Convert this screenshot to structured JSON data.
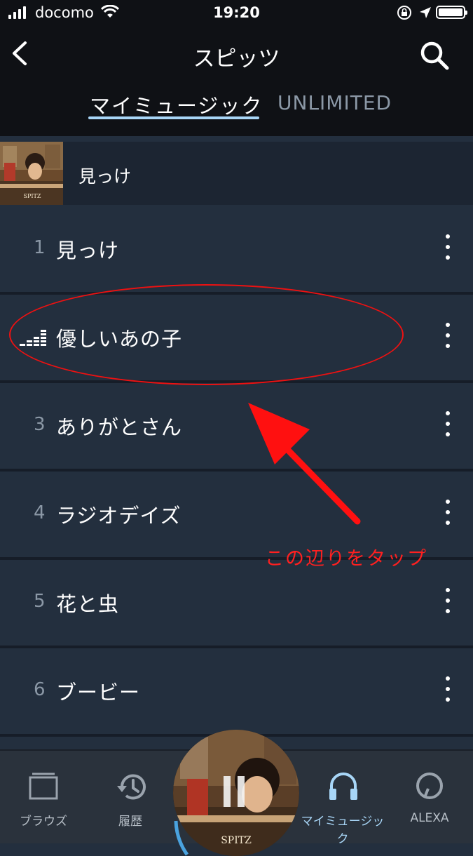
{
  "status": {
    "carrier": "docomo",
    "time": "19:20"
  },
  "header": {
    "title": "スピッツ",
    "tabs": {
      "my_music": "マイミュージック",
      "unlimited": "UNLIMITED"
    }
  },
  "album": {
    "title": "見っけ",
    "art_label": "SPITZ"
  },
  "tracks": [
    {
      "num": "1",
      "title": "見っけ"
    },
    {
      "num": "",
      "title": "優しいあの子"
    },
    {
      "num": "3",
      "title": "ありがとさん"
    },
    {
      "num": "4",
      "title": "ラジオデイズ"
    },
    {
      "num": "5",
      "title": "花と虫"
    },
    {
      "num": "6",
      "title": "ブービー"
    }
  ],
  "annotation": "この辺りをタップ",
  "tabbar": {
    "browse": "ブラウズ",
    "history": "履歴",
    "my_music": "マイミュージック",
    "alexa": "ALEXA"
  },
  "player": {
    "art_label": "SPITZ"
  },
  "colors": {
    "accent": "#a8d6f7",
    "annotation": "#ff2020",
    "background": "#232f3e"
  }
}
